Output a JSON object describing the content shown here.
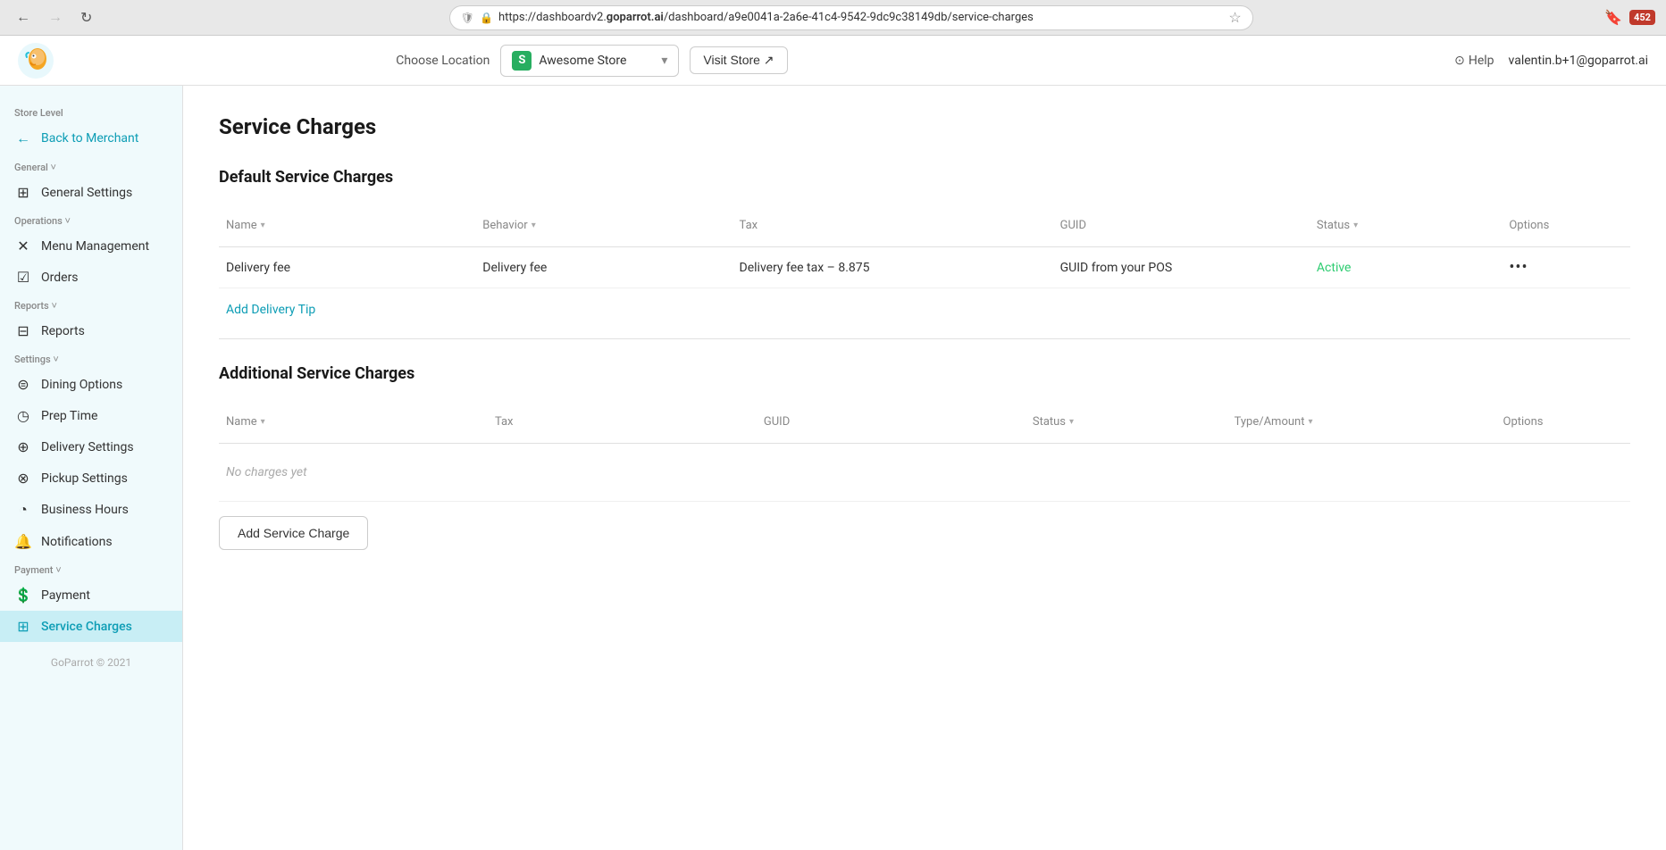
{
  "browser": {
    "back_btn": "←",
    "forward_btn": "→",
    "refresh_btn": "↻",
    "url": "https://dashboardv2.",
    "url_domain": "goparrot.ai",
    "url_path": "/dashboard/a9e0041a-2a6e-41c4-9542-9dc9c38149db/service-charges",
    "ext_badge": "452"
  },
  "header": {
    "choose_location_label": "Choose Location",
    "location_icon_letter": "S",
    "location_name": "Awesome Store",
    "visit_store_label": "Visit Store ↗",
    "help_label": "Help",
    "user_email": "valentin.b+1@goparrot.ai"
  },
  "sidebar": {
    "store_level_label": "Store Level",
    "back_label": "Back to Merchant",
    "general_label": "General ˅",
    "general_settings_label": "General Settings",
    "operations_label": "Operations ˅",
    "menu_management_label": "Menu Management",
    "orders_label": "Orders",
    "reports_label": "Reports ˅",
    "reports_item_label": "Reports",
    "settings_label": "Settings ˅",
    "dining_options_label": "Dining Options",
    "prep_time_label": "Prep Time",
    "delivery_settings_label": "Delivery Settings",
    "pickup_settings_label": "Pickup Settings",
    "business_hours_label": "Business Hours",
    "notifications_label": "Notifications",
    "payment_label": "Payment ˅",
    "payment_item_label": "Payment",
    "service_charges_label": "Service Charges",
    "footer": "GoParrot © 2021"
  },
  "main": {
    "page_title": "Service Charges",
    "default_section_title": "Default Service Charges",
    "default_table": {
      "columns": [
        "Name ▾",
        "Behavior ▾",
        "Tax",
        "GUID",
        "Status ▾",
        "Options"
      ],
      "rows": [
        {
          "name": "Delivery fee",
          "behavior": "Delivery fee",
          "tax": "Delivery fee tax – 8.875",
          "guid": "GUID from your POS",
          "status": "Active",
          "options": "•••"
        }
      ]
    },
    "add_delivery_tip_label": "Add Delivery Tip",
    "additional_section_title": "Additional Service Charges",
    "additional_table": {
      "columns": [
        "Name ▾",
        "Tax",
        "GUID",
        "Status ▾",
        "Type/Amount ▾",
        "Options"
      ],
      "empty_label": "No charges yet"
    },
    "add_service_charge_label": "Add Service Charge"
  }
}
